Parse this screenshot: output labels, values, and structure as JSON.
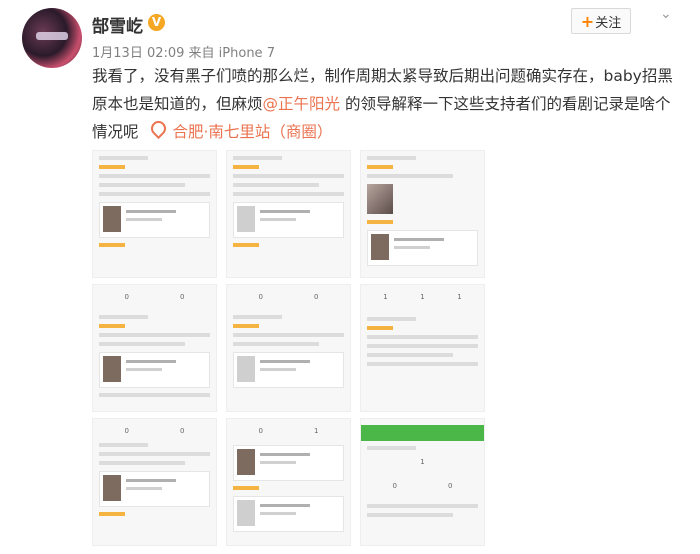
{
  "user": {
    "name": "郜雪屹",
    "verified_badge": "V",
    "meta": "1月13日 02:09 来自 iPhone 7"
  },
  "actions": {
    "follow_plus": "+",
    "follow_label": "关注"
  },
  "post": {
    "text_before_mention": "我看了，没有黑子们喷的那么烂，制作周期太紧导致后期出问题确实存在，baby招黑原本也是知道的，但麻烦",
    "mention": "@正午阳光",
    "text_after_mention": " 的领导解释一下这些支持者们的看剧记录是啥个情况呢",
    "location": "合肥·南七里站（商圈）"
  },
  "colors": {
    "accent_orange": "#eb7350",
    "follow_plus": "#ff8200",
    "badge": "#f5a623"
  },
  "icons": [
    "avatar",
    "verified-badge-icon",
    "chevron-down-icon",
    "location-pin-icon"
  ]
}
